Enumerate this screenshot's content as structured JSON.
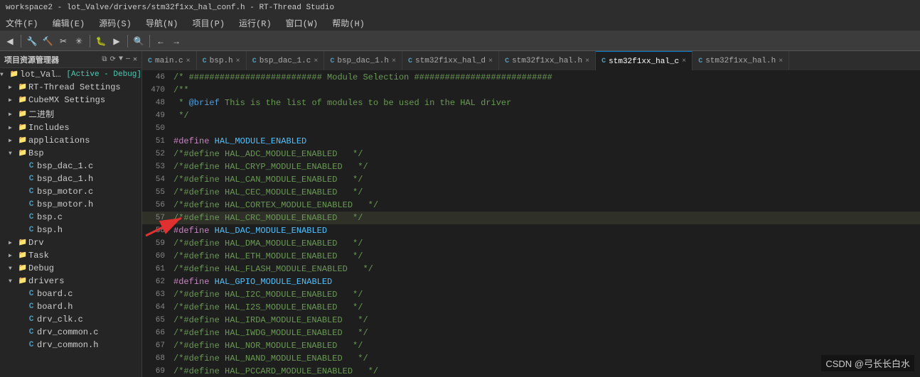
{
  "titleBar": {
    "text": "workspace2 - lot_Valve/drivers/stm32f1xx_hal_conf.h - RT-Thread Studio"
  },
  "menuBar": {
    "items": [
      "文件(F)",
      "编辑(E)",
      "源码(S)",
      "导航(N)",
      "项目(P)",
      "运行(R)",
      "窗口(W)",
      "帮助(H)"
    ]
  },
  "tabs": [
    {
      "icon": "C",
      "label": "main.c",
      "active": false
    },
    {
      "icon": "C",
      "label": "bsp.h",
      "active": false
    },
    {
      "icon": "C",
      "label": "bsp_dac_1.c",
      "active": false
    },
    {
      "icon": "C",
      "label": "bsp_dac_1.h",
      "active": false
    },
    {
      "icon": "C",
      "label": "stm32f1xx_hal_d",
      "active": false
    },
    {
      "icon": "C",
      "label": "stm32f1xx_hal.h",
      "active": false
    },
    {
      "icon": "C",
      "label": "stm32f1xx_hal_c",
      "active": true
    },
    {
      "icon": "C",
      "label": "stm32f1xx_hal.h",
      "active": false
    }
  ],
  "sidebar": {
    "title": "项目资源管理器",
    "tree": [
      {
        "level": 0,
        "type": "root",
        "label": "lot_Valve",
        "tag": "[Active - Debug]",
        "expanded": true,
        "arrow": "▼"
      },
      {
        "level": 1,
        "type": "folder",
        "label": "RT-Thread Settings",
        "expanded": false,
        "arrow": "▶"
      },
      {
        "level": 1,
        "type": "folder",
        "label": "CubeMX Settings",
        "expanded": false,
        "arrow": "▶"
      },
      {
        "level": 1,
        "type": "folder",
        "label": "二进制",
        "expanded": false,
        "arrow": "▶"
      },
      {
        "level": 1,
        "type": "folder",
        "label": "Includes",
        "expanded": false,
        "arrow": "▶"
      },
      {
        "level": 1,
        "type": "folder",
        "label": "applications",
        "expanded": false,
        "arrow": "▶"
      },
      {
        "level": 1,
        "type": "folder-open",
        "label": "Bsp",
        "expanded": true,
        "arrow": "▼"
      },
      {
        "level": 2,
        "type": "cfile",
        "label": "bsp_dac_1.c",
        "arrow": ""
      },
      {
        "level": 2,
        "type": "cfile",
        "label": "bsp_dac_1.h",
        "arrow": ""
      },
      {
        "level": 2,
        "type": "cfile",
        "label": "bsp_motor.c",
        "arrow": ""
      },
      {
        "level": 2,
        "type": "cfile",
        "label": "bsp_motor.h",
        "arrow": ""
      },
      {
        "level": 2,
        "type": "cfile",
        "label": "bsp.c",
        "arrow": ""
      },
      {
        "level": 2,
        "type": "cfile",
        "label": "bsp.h",
        "arrow": ""
      },
      {
        "level": 1,
        "type": "folder",
        "label": "Drv",
        "expanded": false,
        "arrow": "▶"
      },
      {
        "level": 1,
        "type": "folder",
        "label": "Task",
        "expanded": false,
        "arrow": "▶"
      },
      {
        "level": 1,
        "type": "folder-open",
        "label": "Debug",
        "expanded": true,
        "arrow": "▼"
      },
      {
        "level": 1,
        "type": "folder-open",
        "label": "drivers",
        "expanded": true,
        "arrow": "▼"
      },
      {
        "level": 2,
        "type": "cfile",
        "label": "board.c",
        "arrow": ""
      },
      {
        "level": 2,
        "type": "cfile",
        "label": "board.h",
        "arrow": ""
      },
      {
        "level": 2,
        "type": "cfile",
        "label": "drv_clk.c",
        "arrow": ""
      },
      {
        "level": 2,
        "type": "cfile",
        "label": "drv_common.c",
        "arrow": ""
      },
      {
        "level": 2,
        "type": "cfile",
        "label": "drv_common.h",
        "arrow": ""
      }
    ]
  },
  "codeLines": [
    {
      "num": "46",
      "content": "/* ########################## Module Selection ###########################",
      "type": "comment"
    },
    {
      "num": "470",
      "content": "/**",
      "type": "comment"
    },
    {
      "num": "48",
      "content": " * @brief This is the list of modules to be used in the HAL driver",
      "type": "comment-brief"
    },
    {
      "num": "49",
      "content": " */",
      "type": "comment"
    },
    {
      "num": "50",
      "content": "",
      "type": "empty"
    },
    {
      "num": "51",
      "content": "#define HAL_MODULE_ENABLED",
      "type": "define"
    },
    {
      "num": "52",
      "content": "/*#define HAL_ADC_MODULE_ENABLED   */",
      "type": "comment"
    },
    {
      "num": "53",
      "content": "/*#define HAL_CRYP_MODULE_ENABLED   */",
      "type": "comment"
    },
    {
      "num": "54",
      "content": "/*#define HAL_CAN_MODULE_ENABLED   */",
      "type": "comment"
    },
    {
      "num": "55",
      "content": "/*#define HAL_CEC_MODULE_ENABLED   */",
      "type": "comment"
    },
    {
      "num": "56",
      "content": "/*#define HAL_CORTEX_MODULE_ENABLED   */",
      "type": "comment"
    },
    {
      "num": "57",
      "content": "/*#define HAL_CRC_MODULE_ENABLED   */",
      "type": "comment",
      "highlighted": true
    },
    {
      "num": "58",
      "content": "#define HAL_DAC_MODULE_ENABLED",
      "type": "define"
    },
    {
      "num": "59",
      "content": "/*#define HAL_DMA_MODULE_ENABLED   */",
      "type": "comment"
    },
    {
      "num": "60",
      "content": "/*#define HAL_ETH_MODULE_ENABLED   */",
      "type": "comment"
    },
    {
      "num": "61",
      "content": "/*#define HAL_FLASH_MODULE_ENABLED   */",
      "type": "comment"
    },
    {
      "num": "62",
      "content": "#define HAL_GPIO_MODULE_ENABLED",
      "type": "define"
    },
    {
      "num": "63",
      "content": "/*#define HAL_I2C_MODULE_ENABLED   */",
      "type": "comment"
    },
    {
      "num": "64",
      "content": "/*#define HAL_I2S_MODULE_ENABLED   */",
      "type": "comment"
    },
    {
      "num": "65",
      "content": "/*#define HAL_IRDA_MODULE_ENABLED   */",
      "type": "comment"
    },
    {
      "num": "66",
      "content": "/*#define HAL_IWDG_MODULE_ENABLED   */",
      "type": "comment"
    },
    {
      "num": "67",
      "content": "/*#define HAL_NOR_MODULE_ENABLED   */",
      "type": "comment"
    },
    {
      "num": "68",
      "content": "/*#define HAL_NAND_MODULE_ENABLED   */",
      "type": "comment"
    },
    {
      "num": "69",
      "content": "/*#define HAL_PCCARD_MODULE_ENABLED   */",
      "type": "comment"
    }
  ],
  "watermark": "CSDN @弓长长白水"
}
